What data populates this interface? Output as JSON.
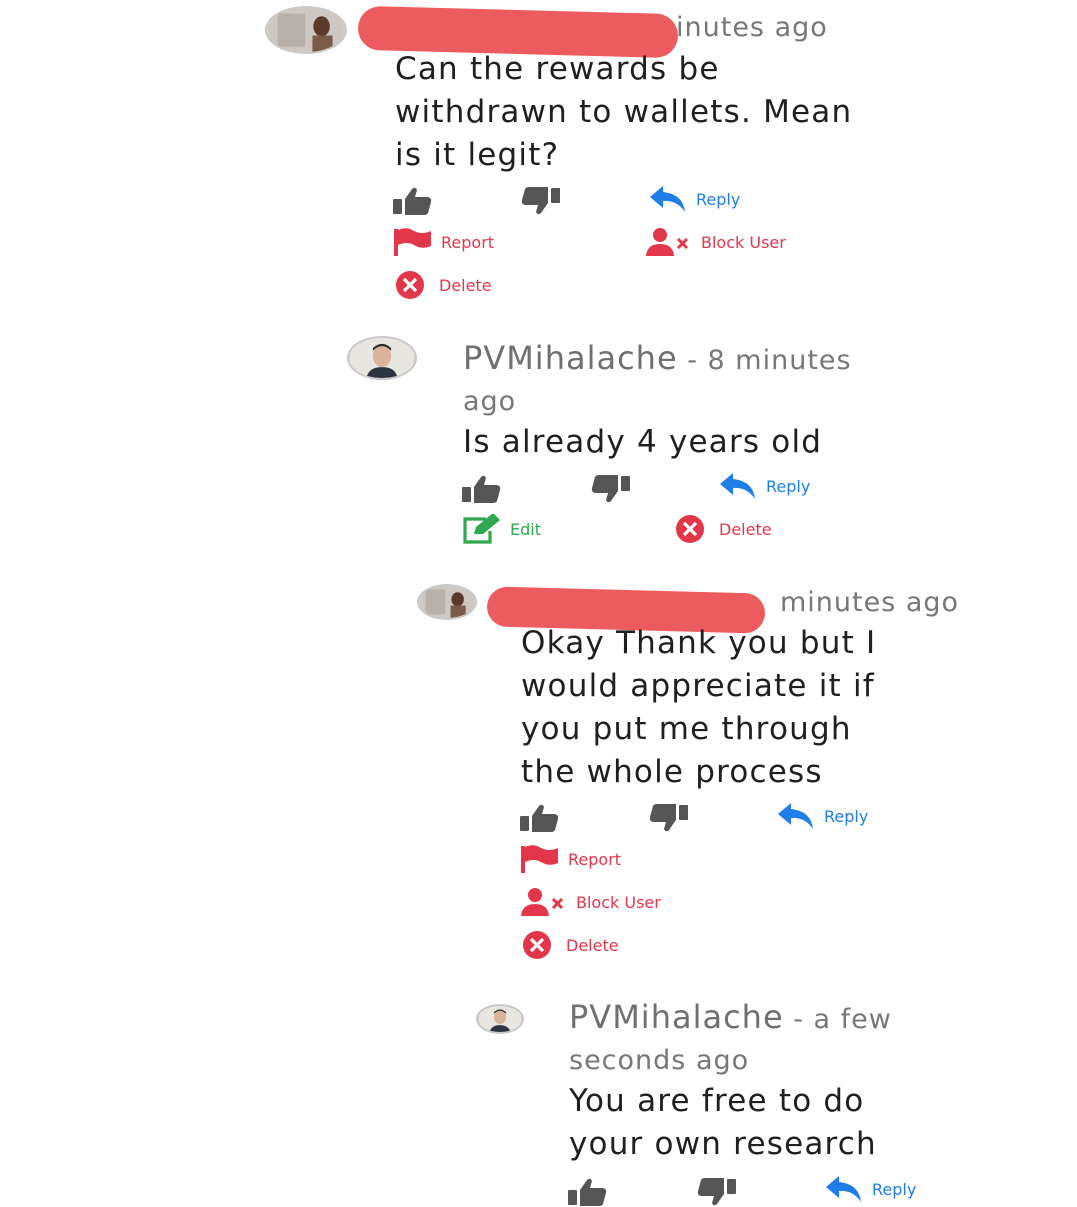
{
  "comments": [
    {
      "author_suffix": "inutes ago",
      "text_lines": [
        "Can the rewards be",
        "withdrawn to wallets. Mean",
        "is it legit?"
      ],
      "actions": {
        "reply": "Reply",
        "report": "Report",
        "block": "Block User",
        "delete": "Delete"
      }
    },
    {
      "author": "PVMihalache",
      "time_first": " - 8 minutes",
      "time_second": "ago",
      "text_lines": [
        "Is already 4 years old"
      ],
      "actions": {
        "reply": "Reply",
        "edit": "Edit",
        "delete": "Delete"
      }
    },
    {
      "author_suffix": "minutes ago",
      "text_lines": [
        "Okay Thank you but I",
        "would appreciate it if",
        "you put me through",
        "the whole process"
      ],
      "actions": {
        "reply": "Reply",
        "report": "Report",
        "block": "Block User",
        "delete": "Delete"
      }
    },
    {
      "author": "PVMihalache",
      "time_first": " - a few",
      "time_second": "seconds ago",
      "text_lines": [
        "You are free to do",
        "your own research"
      ],
      "actions": {
        "reply": "Reply"
      }
    }
  ],
  "icons": {
    "like": "thumbs-up-icon",
    "dislike": "thumbs-down-icon",
    "reply": "reply-arrow-icon",
    "report": "flag-icon",
    "block": "user-times-icon",
    "delete": "times-circle-icon",
    "edit": "edit-icon"
  },
  "colors": {
    "reply": "#1f7ee8",
    "danger": "#e2374b",
    "edit": "#2fa84f",
    "vote": "#555555",
    "redaction": "#ec5b5f"
  }
}
